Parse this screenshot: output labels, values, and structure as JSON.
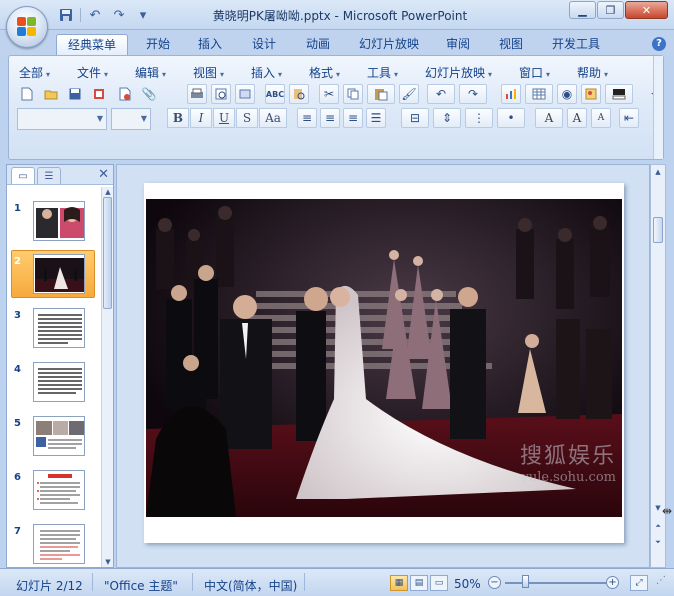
{
  "window": {
    "title": "黄晓明PK屠呦呦.pptx - Microsoft PowerPoint",
    "minimize": "▁",
    "restore": "❐",
    "close": "✕"
  },
  "quick_access": {
    "save_icon": "save-icon",
    "undo_icon": "undo-icon",
    "redo_icon": "redo-icon",
    "customize": "▾"
  },
  "tabs": [
    "经典菜单",
    "开始",
    "插入",
    "设计",
    "动画",
    "幻灯片放映",
    "审阅",
    "视图",
    "开发工具"
  ],
  "active_tab": "经典菜单",
  "menus": [
    "全部",
    "文件",
    "编辑",
    "视图",
    "插入",
    "格式",
    "工具",
    "幻灯片放映",
    "窗口",
    "帮助"
  ],
  "format_buttons": [
    "B",
    "I",
    "U",
    "S",
    "Aa"
  ],
  "slides_panel": {
    "close": "✕",
    "slide_numbers": [
      "1",
      "2",
      "3",
      "4",
      "5",
      "6",
      "7"
    ],
    "selected": 2
  },
  "watermark": {
    "line1": "搜狐娱乐",
    "line2": "yule.sohu.com"
  },
  "status": {
    "slide": "幻灯片 2/12",
    "theme": "\"Office 主题\"",
    "language": "中文(简体，中国)",
    "zoom": "50%"
  },
  "colors": {
    "ribbon_bg": "#dfeaf8",
    "accent_selected": "#f7a93c",
    "title_text": "#15428b"
  }
}
